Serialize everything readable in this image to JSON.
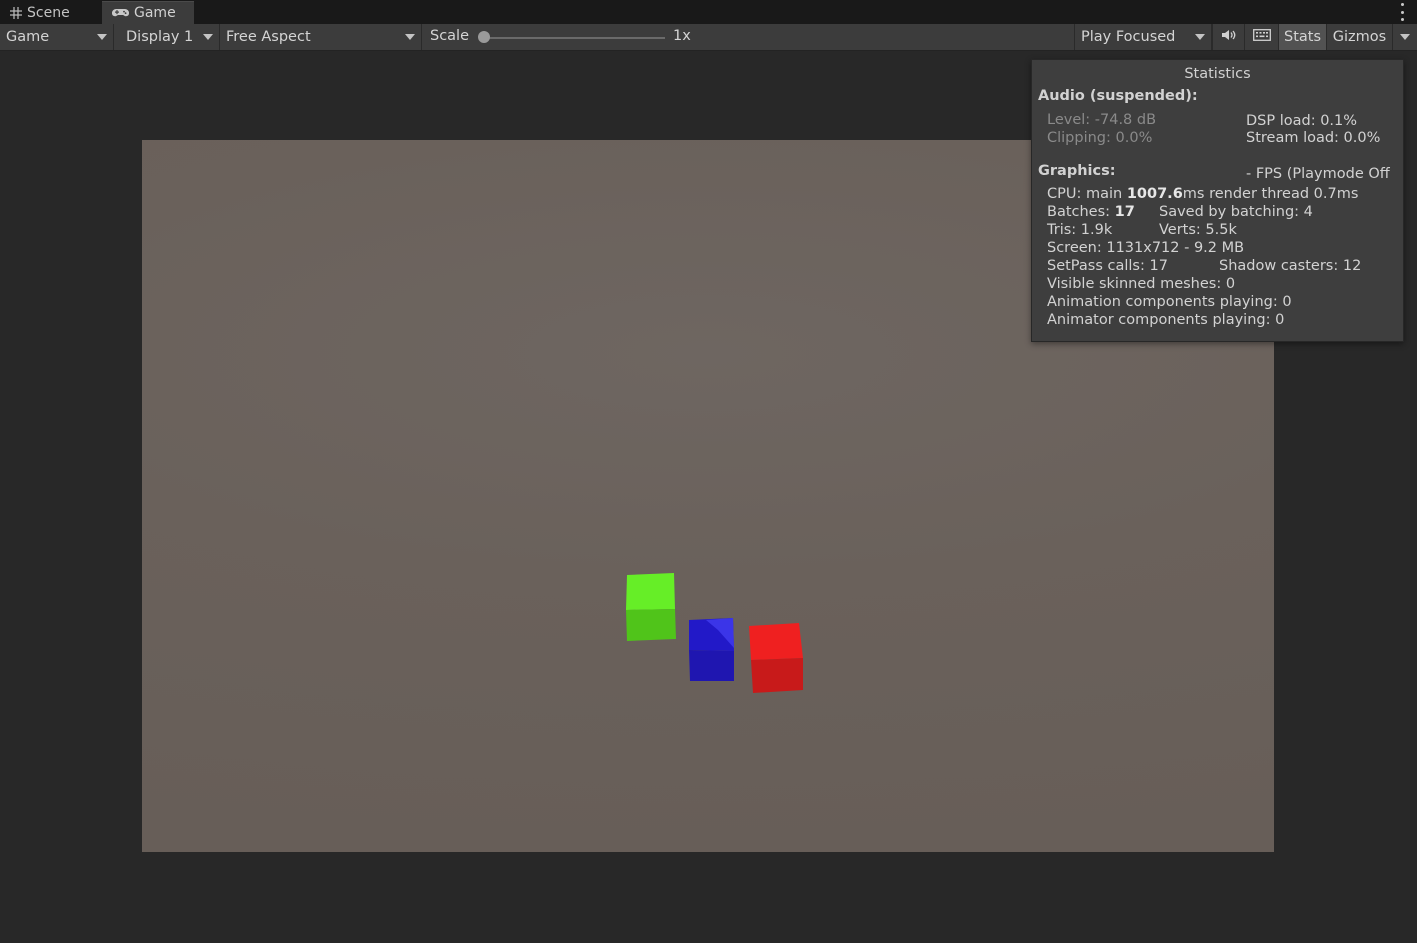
{
  "tabs": [
    {
      "label": "Scene",
      "icon": "grid-icon"
    },
    {
      "label": "Game",
      "icon": "gamepad-icon"
    }
  ],
  "toolbar": {
    "view_mode": "Game",
    "display": "Display 1",
    "aspect": "Free Aspect",
    "scale_label": "Scale",
    "scale_value": "1x",
    "play_mode": "Play Focused",
    "stats_label": "Stats",
    "gizmos_label": "Gizmos"
  },
  "colors": {
    "green_cube": "#5fe021",
    "blue_cube": "#2a19c4",
    "red_cube": "#e01c1c",
    "background": "#282828",
    "viewport": "#6a615b"
  },
  "stats": {
    "title": "Statistics",
    "audio_header": "Audio (suspended):",
    "level": "Level: -74.8 dB",
    "clipping": "Clipping: 0.0%",
    "dsp_load": "DSP load: 0.1%",
    "stream_load": "Stream load: 0.0%",
    "graphics_header": "Graphics:",
    "fps": "- FPS (Playmode Off",
    "cpu_prefix": "CPU: main ",
    "cpu_main": "1007.6",
    "cpu_suffix": "ms  render thread 0.7ms",
    "batches_prefix": "Batches: ",
    "batches": "17",
    "saved_by_batching": "Saved by batching: 4",
    "tris": "Tris: 1.9k",
    "verts": "Verts: 5.5k",
    "screen": "Screen: 1131x712 - 9.2 MB",
    "setpass": "SetPass calls: 17",
    "shadow_casters": "Shadow casters: 12",
    "skinned_meshes": "Visible skinned meshes: 0",
    "animation_components": "Animation components playing: 0",
    "animator_components": "Animator components playing: 0"
  }
}
